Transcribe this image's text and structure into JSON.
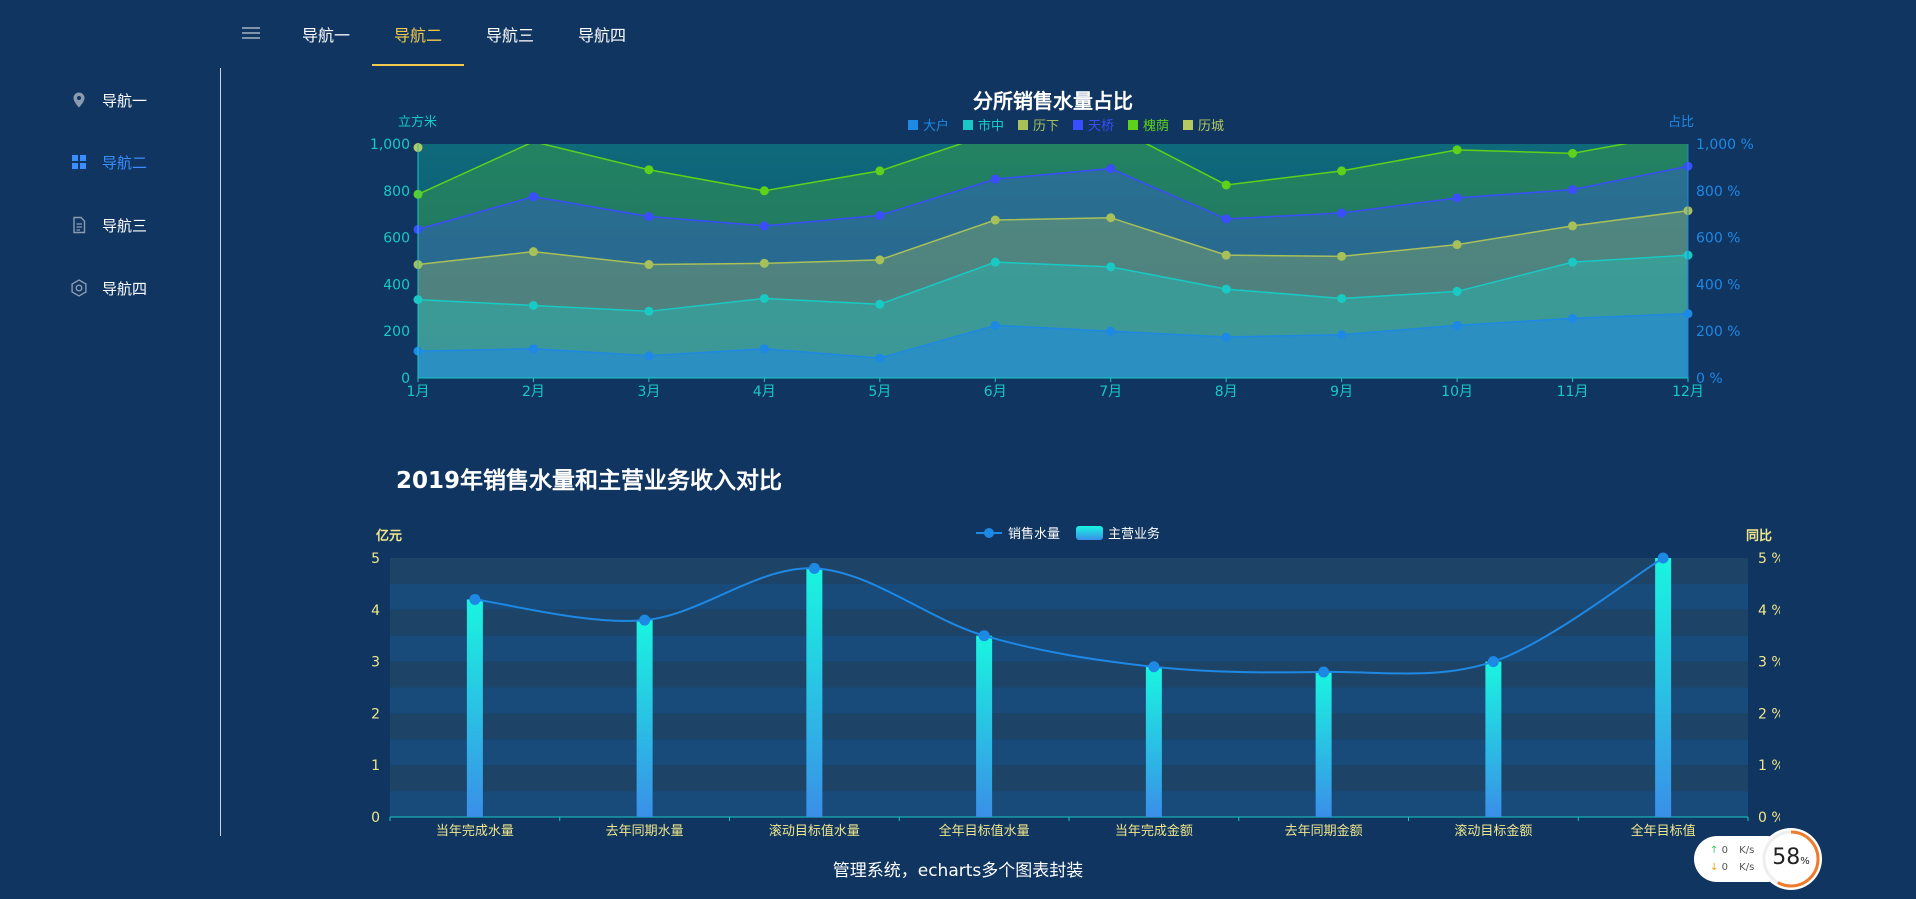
{
  "topnav": {
    "tabs": [
      {
        "label": "导航一"
      },
      {
        "label": "导航二"
      },
      {
        "label": "导航三"
      },
      {
        "label": "导航四"
      }
    ],
    "active_index": 1
  },
  "sidebar": {
    "items": [
      {
        "label": "导航一",
        "icon": "location-pin-icon"
      },
      {
        "label": "导航二",
        "icon": "grid-icon"
      },
      {
        "label": "导航三",
        "icon": "document-icon"
      },
      {
        "label": "导航四",
        "icon": "gear-icon"
      }
    ],
    "active_index": 1
  },
  "colors": {
    "background": "#0f3560",
    "active_tab": "#f2c94c",
    "active_sidebar": "#3c8dff"
  },
  "chart_data": [
    {
      "type": "area",
      "title": "分所销售水量占比",
      "ylabel": "立方米",
      "y2label": "占比",
      "ylim": [
        0,
        1000
      ],
      "yticks": [
        "0",
        "200",
        "400",
        "600",
        "800",
        "1,000"
      ],
      "y2ticks": [
        "0 %",
        "200 %",
        "400 %",
        "600 %",
        "800 %",
        "1,000 %"
      ],
      "categories": [
        "1月",
        "2月",
        "3月",
        "4月",
        "5月",
        "6月",
        "7月",
        "8月",
        "9月",
        "10月",
        "11月",
        "12月"
      ],
      "stacked": false,
      "legend_position": "top-center",
      "series": [
        {
          "name": "大户",
          "color": "#1e88e5",
          "values": [
            115,
            125,
            95,
            125,
            85,
            225,
            200,
            175,
            185,
            225,
            255,
            275
          ]
        },
        {
          "name": "市中",
          "color": "#19c9c3",
          "values": [
            335,
            310,
            285,
            340,
            315,
            495,
            475,
            380,
            340,
            370,
            495,
            525
          ]
        },
        {
          "name": "历下",
          "color": "#a8c05a",
          "values": [
            485,
            540,
            485,
            490,
            505,
            675,
            685,
            525,
            520,
            570,
            650,
            715
          ]
        },
        {
          "name": "天桥",
          "color": "#3a4dff",
          "values": [
            635,
            775,
            690,
            650,
            695,
            850,
            895,
            680,
            705,
            770,
            805,
            905
          ]
        },
        {
          "name": "槐荫",
          "color": "#5ed11a",
          "values": [
            785,
            1010,
            890,
            800,
            885,
            1050,
            1080,
            825,
            885,
            975,
            960,
            1050
          ]
        },
        {
          "name": "历城",
          "color": "#b5c960",
          "values": [
            985,
            null,
            null,
            null,
            null,
            null,
            null,
            null,
            null,
            null,
            null,
            null
          ]
        }
      ]
    },
    {
      "type": "bar",
      "title": "2019年销售水量和主营业务收入对比",
      "ylabel": "亿元",
      "y2label": "同比",
      "ylim": [
        0,
        5
      ],
      "yticks": [
        "0",
        "1",
        "2",
        "3",
        "4",
        "5"
      ],
      "y2ticks": [
        "0 %",
        "1 %",
        "2 %",
        "3 %",
        "4 %",
        "5 %"
      ],
      "categories": [
        "当年完成水量",
        "去年同期水量",
        "滚动目标值水量",
        "全年目标值水量",
        "当年完成金额",
        "去年同期金额",
        "滚动目标金额",
        "全年目标值"
      ],
      "legend_position": "top-center",
      "series": [
        {
          "name": "主营业务",
          "kind": "bar",
          "values": [
            4.2,
            3.8,
            4.8,
            3.5,
            2.9,
            2.8,
            3.0,
            5.0
          ]
        },
        {
          "name": "销售水量",
          "kind": "line",
          "values": [
            4.2,
            3.8,
            4.8,
            3.5,
            2.9,
            2.8,
            3.0,
            5.0
          ]
        }
      ]
    }
  ],
  "footer": {
    "text": "管理系统，echarts多个图表封装"
  },
  "speed_widget": {
    "up": "0",
    "down": "0",
    "unit": "K/s",
    "percent": "58",
    "percent_sign": "%",
    "percent_value": 58
  }
}
